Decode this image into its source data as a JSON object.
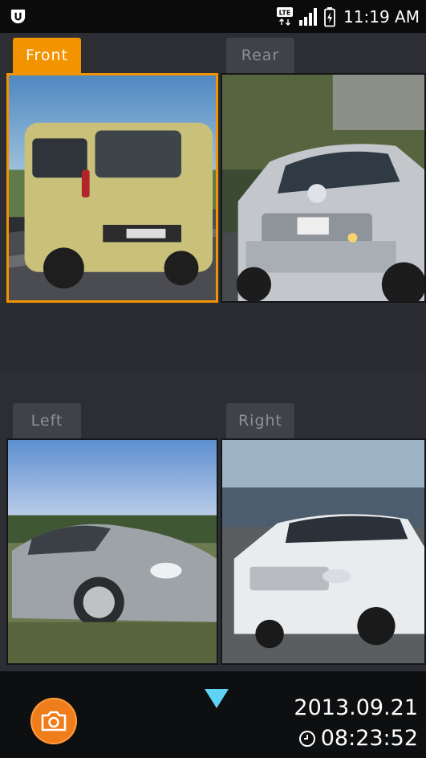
{
  "status_bar": {
    "time": "11:19 AM",
    "network_label": "LTE",
    "icons": [
      "app-logo-icon",
      "lte-icon",
      "signal-icon",
      "battery-charging-icon"
    ]
  },
  "cameras": {
    "front": {
      "tab_label": "Front",
      "selected": true,
      "scene": "yellow compact car, rear view on highway"
    },
    "rear": {
      "tab_label": "Rear",
      "selected": false,
      "scene": "silver SUV front view"
    },
    "left": {
      "tab_label": "Left",
      "selected": false,
      "scene": "silver sports car side view"
    },
    "right": {
      "tab_label": "Right",
      "selected": false,
      "scene": "white SUV front view on road"
    }
  },
  "bottom_bar": {
    "date": "2013.09.21",
    "time": "08:23:52",
    "capture_icon": "camera-icon",
    "expand_icon": "triangle-down-icon",
    "clock_icon": "clock-icon"
  },
  "colors": {
    "accent": "#f39300",
    "capture_button": "#f07d1c",
    "expand_arrow": "#5fd3f5",
    "tab_inactive": "#3f4248",
    "background": "#2c2e33"
  }
}
